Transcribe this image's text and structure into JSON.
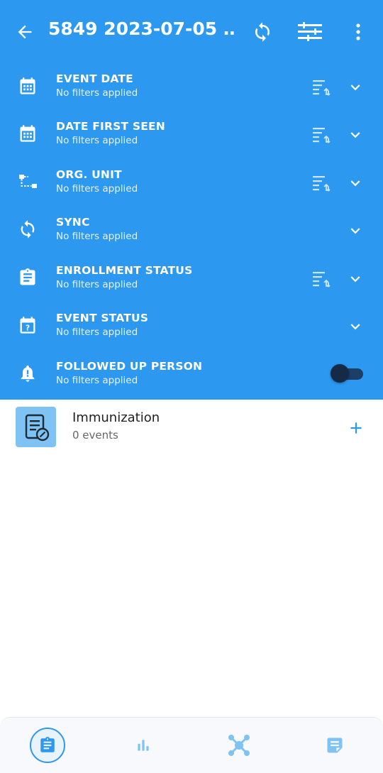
{
  "topbar": {
    "title": "5849 2023-07-05 …",
    "icons": [
      "back-arrow-icon",
      "sync-icon",
      "filter-list-icon",
      "more-vert-icon"
    ]
  },
  "filters": [
    {
      "title": "EVENT DATE",
      "subtitle": "No filters applied",
      "icon": "calendar-icon",
      "sortable": true,
      "control": "expand"
    },
    {
      "title": "DATE FIRST SEEN",
      "subtitle": "No filters applied",
      "icon": "calendar-icon",
      "sortable": true,
      "control": "expand"
    },
    {
      "title": "ORG. UNIT",
      "subtitle": "No filters applied",
      "icon": "org-unit-icon",
      "sortable": true,
      "control": "expand"
    },
    {
      "title": "SYNC",
      "subtitle": "No filters applied",
      "icon": "sync-icon",
      "sortable": false,
      "control": "expand"
    },
    {
      "title": "ENROLLMENT STATUS",
      "subtitle": "No filters applied",
      "icon": "clipboard-icon",
      "sortable": true,
      "control": "expand"
    },
    {
      "title": "EVENT STATUS",
      "subtitle": "No filters applied",
      "icon": "calendar-question-icon",
      "sortable": false,
      "control": "expand"
    },
    {
      "title": "FOLLOWED UP PERSON",
      "subtitle": "No filters applied",
      "icon": "bell-alert-icon",
      "sortable": false,
      "control": "toggle",
      "toggle_on": false
    }
  ],
  "program": {
    "name": "Immunization",
    "count": "0 events",
    "icon": "document-edit-icon"
  },
  "bottom_nav": {
    "items": [
      {
        "icon": "clipboard-icon",
        "active": true
      },
      {
        "icon": "bar-chart-icon",
        "active": false
      },
      {
        "icon": "network-icon",
        "active": false
      },
      {
        "icon": "note-icon",
        "active": false
      }
    ]
  },
  "colors": {
    "primary": "#2c98f0",
    "toggle_off": "#152a47",
    "card_icon_bg": "#7ec3f4",
    "nav_icon": "#7ec3f4"
  }
}
